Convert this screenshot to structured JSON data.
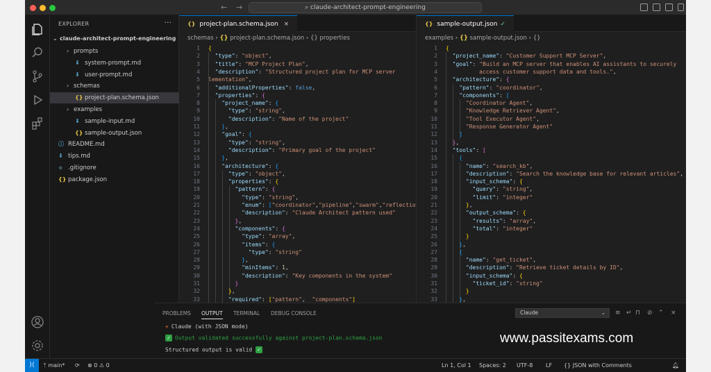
{
  "titlebar": {
    "search": "claude-architect-prompt-engineering"
  },
  "colors": {
    "accent": "#0078d4",
    "json_icon": "#e7c547",
    "md_icon": "#519aba",
    "success": "#2ea043"
  },
  "explorer": {
    "title": "EXPLORER",
    "more": "···",
    "root": "claude-architect-prompt-engineering",
    "items": [
      {
        "label": "prompts",
        "type": "folder",
        "icon": "chevron-right-icon"
      },
      {
        "label": "system-prompt.md",
        "type": "md",
        "icon": "markdown-file-icon"
      },
      {
        "label": "user-prompt.md",
        "type": "md",
        "icon": "markdown-file-icon"
      },
      {
        "label": "schemas",
        "type": "folder",
        "icon": "chevron-right-icon"
      },
      {
        "label": "project-plan.schema.json",
        "type": "json",
        "icon": "json-file-icon"
      },
      {
        "label": "examples",
        "type": "folder",
        "icon": "chevron-right-icon"
      },
      {
        "label": "sample-input.md",
        "type": "md",
        "icon": "markdown-file-icon"
      },
      {
        "label": "sample-output.json",
        "type": "json",
        "icon": "json-file-icon"
      },
      {
        "label": "README.md",
        "type": "info",
        "icon": "info-file-icon"
      },
      {
        "label": "tips.md",
        "type": "md",
        "icon": "markdown-file-icon"
      },
      {
        "label": ".gitignore",
        "type": "git",
        "icon": "git-file-icon"
      },
      {
        "label": "package.json",
        "type": "json",
        "icon": "json-file-icon"
      }
    ]
  },
  "editor_left": {
    "tab": "project-plan.schema.json",
    "breadcrumb": [
      "schemas",
      "project-plan.schema.json",
      "properties"
    ],
    "lines": [
      [
        [
          "p1",
          "{"
        ]
      ],
      [
        [
          "",
          "  "
        ],
        [
          "k",
          "\"type\""
        ],
        [
          "",
          ": "
        ],
        [
          "s",
          "\"object\""
        ],
        [
          "",
          ","
        ]
      ],
      [
        [
          "",
          "  "
        ],
        [
          "k",
          "\"title\""
        ],
        [
          "",
          ": "
        ],
        [
          "s",
          "\"MCP Project Plan\""
        ],
        [
          "",
          ","
        ]
      ],
      [
        [
          "",
          "  "
        ],
        [
          "k",
          "\"description\""
        ],
        [
          "",
          ": "
        ],
        [
          "s",
          "\"Structured project plan for MCP server"
        ]
      ],
      [
        [
          "s",
          "lementation\""
        ],
        [
          "",
          ","
        ]
      ],
      [
        [
          "",
          "  "
        ],
        [
          "k",
          "\"additionalProperties\""
        ],
        [
          "",
          ": "
        ],
        [
          "b",
          "false"
        ],
        [
          "",
          ","
        ]
      ],
      [
        [
          "",
          "  "
        ],
        [
          "k",
          "\"properties\""
        ],
        [
          "",
          ": "
        ],
        [
          "p2",
          "{"
        ]
      ],
      [
        [
          "",
          "    "
        ],
        [
          "k",
          "\"project_name\""
        ],
        [
          "",
          ": "
        ],
        [
          "p3",
          "{"
        ]
      ],
      [
        [
          "",
          "      "
        ],
        [
          "k",
          "\"type\""
        ],
        [
          "",
          ": "
        ],
        [
          "s",
          "\"string\""
        ],
        [
          "",
          ","
        ]
      ],
      [
        [
          "",
          "      "
        ],
        [
          "k",
          "\"description\""
        ],
        [
          "",
          ": "
        ],
        [
          "s",
          "\"Name of the project\""
        ]
      ],
      [
        [
          "",
          "    "
        ],
        [
          "p3",
          "}"
        ],
        [
          "",
          ","
        ]
      ],
      [
        [
          "",
          "    "
        ],
        [
          "k",
          "\"goal\""
        ],
        [
          "",
          ": "
        ],
        [
          "p3",
          "{"
        ]
      ],
      [
        [
          "",
          "      "
        ],
        [
          "k",
          "\"type\""
        ],
        [
          "",
          ": "
        ],
        [
          "s",
          "\"string\""
        ],
        [
          "",
          ","
        ]
      ],
      [
        [
          "",
          "      "
        ],
        [
          "k",
          "\"description\""
        ],
        [
          "",
          ": "
        ],
        [
          "s",
          "\"Primary goal of the project\""
        ]
      ],
      [
        [
          "",
          "    "
        ],
        [
          "p3",
          "}"
        ],
        [
          "",
          ","
        ]
      ],
      [
        [
          "",
          "    "
        ],
        [
          "k",
          "\"architecture\""
        ],
        [
          "",
          ": "
        ],
        [
          "p3",
          "{"
        ]
      ],
      [
        [
          "",
          "      "
        ],
        [
          "k",
          "\"type\""
        ],
        [
          "",
          ": "
        ],
        [
          "s",
          "\"object\""
        ],
        [
          "",
          ","
        ]
      ],
      [
        [
          "",
          "      "
        ],
        [
          "k",
          "\"properties\""
        ],
        [
          "",
          ": "
        ],
        [
          "p1",
          "{"
        ]
      ],
      [
        [
          "",
          "        "
        ],
        [
          "k",
          "\"pattern\""
        ],
        [
          "",
          ": "
        ],
        [
          "p2",
          "{"
        ]
      ],
      [
        [
          "",
          "          "
        ],
        [
          "k",
          "\"type\""
        ],
        [
          "",
          ": "
        ],
        [
          "s",
          "\"string\""
        ],
        [
          "",
          ","
        ]
      ],
      [
        [
          "",
          "          "
        ],
        [
          "k",
          "\"enum\""
        ],
        [
          "",
          ": "
        ],
        [
          "p3",
          "["
        ],
        [
          "s",
          "\"coordinator\""
        ],
        [
          "",
          ","
        ],
        [
          "s",
          "\"pipeline\""
        ],
        [
          "",
          ","
        ],
        [
          "s",
          "\"swarm\""
        ],
        [
          "",
          ","
        ],
        [
          "s",
          "\"reflection_loop\""
        ],
        [
          "p3",
          "]"
        ],
        [
          "",
          ","
        ]
      ],
      [
        [
          "",
          "          "
        ],
        [
          "k",
          "\"description\""
        ],
        [
          "",
          ": "
        ],
        [
          "s",
          "\"Claude Architect pattern used\""
        ]
      ],
      [
        [
          "",
          "        "
        ],
        [
          "p2",
          "}"
        ],
        [
          "",
          ","
        ]
      ],
      [
        [
          "",
          "        "
        ],
        [
          "k",
          "\"components\""
        ],
        [
          "",
          ": "
        ],
        [
          "p2",
          "{"
        ]
      ],
      [
        [
          "",
          "          "
        ],
        [
          "k",
          "\"type\""
        ],
        [
          "",
          ": "
        ],
        [
          "s",
          "\"array\""
        ],
        [
          "",
          ","
        ]
      ],
      [
        [
          "",
          "          "
        ],
        [
          "k",
          "\"items\""
        ],
        [
          "",
          ": "
        ],
        [
          "p3",
          "{"
        ]
      ],
      [
        [
          "",
          "            "
        ],
        [
          "k",
          "\"type\""
        ],
        [
          "",
          ": "
        ],
        [
          "s",
          "\"string\""
        ]
      ],
      [
        [
          "",
          "          "
        ],
        [
          "p3",
          "}"
        ],
        [
          "",
          ","
        ]
      ],
      [
        [
          "",
          "          "
        ],
        [
          "k",
          "\"minItems\""
        ],
        [
          "",
          ": "
        ],
        [
          "n",
          "1"
        ],
        [
          "",
          ","
        ]
      ],
      [
        [
          "",
          "          "
        ],
        [
          "k",
          "\"description\""
        ],
        [
          "",
          ": "
        ],
        [
          "s",
          "\"Key components in the system\""
        ]
      ],
      [
        [
          "",
          "        "
        ],
        [
          "p2",
          "}"
        ]
      ],
      [
        [
          "",
          "      "
        ],
        [
          "p1",
          "}"
        ],
        [
          "",
          ","
        ]
      ],
      [
        [
          "",
          "      "
        ],
        [
          "k",
          "\"required\""
        ],
        [
          "",
          ": "
        ],
        [
          "p1",
          "["
        ],
        [
          "s",
          "\"pattern\""
        ],
        [
          "",
          ",  "
        ],
        [
          "s",
          "\"components\""
        ],
        [
          "p1",
          "]"
        ]
      ],
      [
        [
          "",
          "    "
        ],
        [
          "p3",
          "}"
        ],
        [
          "",
          ","
        ]
      ]
    ]
  },
  "editor_right": {
    "tab": "sample-output.json",
    "breadcrumb": [
      "examples",
      "sample-output.json",
      "{}"
    ],
    "lines": [
      [
        [
          "p1",
          "{"
        ]
      ],
      [
        [
          "",
          "  "
        ],
        [
          "k",
          "\"project_name\""
        ],
        [
          "",
          ": "
        ],
        [
          "s",
          "\"Customer Support MCP Server\""
        ],
        [
          "",
          ","
        ]
      ],
      [
        [
          "",
          "  "
        ],
        [
          "k",
          "\"goal\""
        ],
        [
          "",
          ": "
        ],
        [
          "s",
          "\"Build an MCP server that enables AI assistants to securely"
        ]
      ],
      [
        [
          "s",
          "          access customer support data and tools.\""
        ],
        [
          "",
          ","
        ]
      ],
      [
        [
          "",
          "  "
        ],
        [
          "k",
          "\"architecture\""
        ],
        [
          "",
          ": "
        ],
        [
          "p2",
          "{"
        ]
      ],
      [
        [
          "",
          "    "
        ],
        [
          "k",
          "\"pattern\""
        ],
        [
          "",
          ": "
        ],
        [
          "s",
          "\"coordinator\""
        ],
        [
          "",
          ","
        ]
      ],
      [
        [
          "",
          "    "
        ],
        [
          "k",
          "\"components\""
        ],
        [
          "",
          ": "
        ],
        [
          "p3",
          "["
        ]
      ],
      [
        [
          "",
          "      "
        ],
        [
          "s",
          "\"Coordinator Agent\""
        ],
        [
          "",
          ","
        ]
      ],
      [
        [
          "",
          "      "
        ],
        [
          "s",
          "\"Knowledge Retriever Agent\""
        ],
        [
          "",
          ","
        ]
      ],
      [
        [
          "",
          "      "
        ],
        [
          "s",
          "\"Tool Executor Agent\""
        ],
        [
          "",
          ","
        ]
      ],
      [
        [
          "",
          "      "
        ],
        [
          "s",
          "\"Response Generator Agent\""
        ]
      ],
      [
        [
          "",
          "    "
        ],
        [
          "p3",
          "]"
        ]
      ],
      [
        [
          "",
          "  "
        ],
        [
          "p2",
          "}"
        ],
        [
          "",
          ","
        ]
      ],
      [
        [
          "",
          "  "
        ],
        [
          "k",
          "\"tools\""
        ],
        [
          "",
          ": "
        ],
        [
          "p2",
          "["
        ]
      ],
      [
        [
          "",
          "    "
        ],
        [
          "p3",
          "{"
        ]
      ],
      [
        [
          "",
          "      "
        ],
        [
          "k",
          "\"name\""
        ],
        [
          "",
          ": "
        ],
        [
          "s",
          "\"search_kb\""
        ],
        [
          "",
          ","
        ]
      ],
      [
        [
          "",
          "      "
        ],
        [
          "k",
          "\"description\""
        ],
        [
          "",
          ": "
        ],
        [
          "s",
          "\"Search the knowledge base for relevant articles\""
        ],
        [
          "",
          ","
        ]
      ],
      [
        [
          "",
          "      "
        ],
        [
          "k",
          "\"input_schema\""
        ],
        [
          "",
          ": "
        ],
        [
          "p1",
          "{"
        ]
      ],
      [
        [
          "",
          "        "
        ],
        [
          "k",
          "\"query\""
        ],
        [
          "",
          ": "
        ],
        [
          "s",
          "\"string\""
        ],
        [
          "",
          ","
        ]
      ],
      [
        [
          "",
          "        "
        ],
        [
          "k",
          "\"limit\""
        ],
        [
          "",
          ": "
        ],
        [
          "s",
          "\"integer\""
        ]
      ],
      [
        [
          "",
          "      "
        ],
        [
          "p1",
          "}"
        ],
        [
          "",
          ","
        ]
      ],
      [
        [
          "",
          "      "
        ],
        [
          "k",
          "\"output_schema\""
        ],
        [
          "",
          ": "
        ],
        [
          "p1",
          "{"
        ]
      ],
      [
        [
          "",
          "        "
        ],
        [
          "k",
          "\"results\""
        ],
        [
          "",
          ": "
        ],
        [
          "s",
          "\"array\""
        ],
        [
          "",
          ","
        ]
      ],
      [
        [
          "",
          "        "
        ],
        [
          "k",
          "\"total\""
        ],
        [
          "",
          ": "
        ],
        [
          "s",
          "\"integer\""
        ]
      ],
      [
        [
          "",
          "      "
        ],
        [
          "p1",
          "}"
        ]
      ],
      [
        [
          "",
          "    "
        ],
        [
          "p3",
          "}"
        ],
        [
          "",
          ","
        ]
      ],
      [
        [
          "",
          "    "
        ],
        [
          "p3",
          "{"
        ]
      ],
      [
        [
          "",
          "      "
        ],
        [
          "k",
          "\"name\""
        ],
        [
          "",
          ": "
        ],
        [
          "s",
          "\"get_ticket\""
        ],
        [
          "",
          ","
        ]
      ],
      [
        [
          "",
          "      "
        ],
        [
          "k",
          "\"description\""
        ],
        [
          "",
          ": "
        ],
        [
          "s",
          "\"Retrieve ticket details by ID\""
        ],
        [
          "",
          ","
        ]
      ],
      [
        [
          "",
          "      "
        ],
        [
          "k",
          "\"input_schema\""
        ],
        [
          "",
          ": "
        ],
        [
          "p1",
          "{"
        ]
      ],
      [
        [
          "",
          "        "
        ],
        [
          "k",
          "\"ticket_id\""
        ],
        [
          "",
          ": "
        ],
        [
          "s",
          "\"string\""
        ]
      ],
      [
        [
          "",
          "      "
        ],
        [
          "p1",
          "}"
        ]
      ],
      [
        [
          "",
          "    "
        ],
        [
          "p3",
          "}"
        ],
        [
          "",
          ","
        ]
      ]
    ]
  },
  "panel": {
    "tabs": [
      "PROBLEMS",
      "OUTPUT",
      "TERMINAL",
      "DEBUG CONSOLE"
    ],
    "active_tab": "OUTPUT",
    "channel": "Claude",
    "output": {
      "heading": "Claude (with JSON mode)",
      "validated": "Output validated successfully against project-plan.schema.json",
      "result": "Structured output is valid"
    }
  },
  "watermark": "www.passitexams.com",
  "status": {
    "branch": "main*",
    "errors": "0",
    "warnings": "0",
    "position": "Ln 1, Col 1",
    "spaces": "Spaces: 2",
    "encoding": "UTF-8",
    "eol": "LF",
    "language": "JSON with Comments"
  }
}
